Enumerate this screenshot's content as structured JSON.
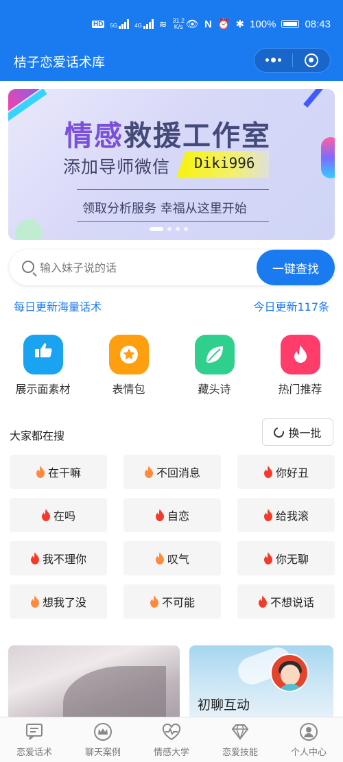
{
  "status_bar": {
    "left_badge": "HD",
    "signal1": "5G",
    "signal2": "4G",
    "net_speed": "31.2",
    "net_unit": "K/s",
    "battery": "100%",
    "time": "08:43"
  },
  "header": {
    "title": "桔子恋爱话术库"
  },
  "banner": {
    "line1_a": "情感",
    "line1_b": "救援工作室",
    "line2": "添加导师微信",
    "wechat_id": "Diki996",
    "line3": "领取分析服务 幸福从这里开始",
    "slide_count": 4,
    "active_slide": 0
  },
  "search": {
    "placeholder": "输入妹子说的话",
    "button": "一键查找"
  },
  "info": {
    "left": "每日更新海量话术",
    "right": "今日更新117条"
  },
  "categories": [
    {
      "label": "展示面素材",
      "icon": "thumbs-up-icon",
      "color": "#1aa3f0"
    },
    {
      "label": "表情包",
      "icon": "star-face-icon",
      "color": "#ff9f0f"
    },
    {
      "label": "藏头诗",
      "icon": "leaf-icon",
      "color": "#2fcf8d"
    },
    {
      "label": "热门推荐",
      "icon": "fire-icon",
      "color": "#ff3c6a"
    }
  ],
  "hot": {
    "title": "大家都在搜",
    "refresh": "换一批",
    "tags": [
      {
        "text": "在干嘛",
        "color": "#ff8a3d"
      },
      {
        "text": "不回消息",
        "color": "#ff8a3d"
      },
      {
        "text": "你好丑",
        "color": "#f23b2a"
      },
      {
        "text": "在吗",
        "color": "#f23b2a"
      },
      {
        "text": "自恋",
        "color": "#f23b2a"
      },
      {
        "text": "给我滚",
        "color": "#f23b2a"
      },
      {
        "text": "我不理你",
        "color": "#f23b2a"
      },
      {
        "text": "叹气",
        "color": "#ff8a3d"
      },
      {
        "text": "你无聊",
        "color": "#f23b2a"
      },
      {
        "text": "想我了没",
        "color": "#ff8a3d"
      },
      {
        "text": "不可能",
        "color": "#ff8a3d"
      },
      {
        "text": "不想说话",
        "color": "#f23b2a"
      }
    ]
  },
  "cards": {
    "card2_title": "初聊互动"
  },
  "tabs": [
    {
      "label": "恋爱话术",
      "icon": "chat-icon"
    },
    {
      "label": "聊天案例",
      "icon": "crown-icon"
    },
    {
      "label": "情感大学",
      "icon": "heart-pulse-icon"
    },
    {
      "label": "恋爱技能",
      "icon": "diamond-icon"
    },
    {
      "label": "个人中心",
      "icon": "user-icon"
    }
  ]
}
